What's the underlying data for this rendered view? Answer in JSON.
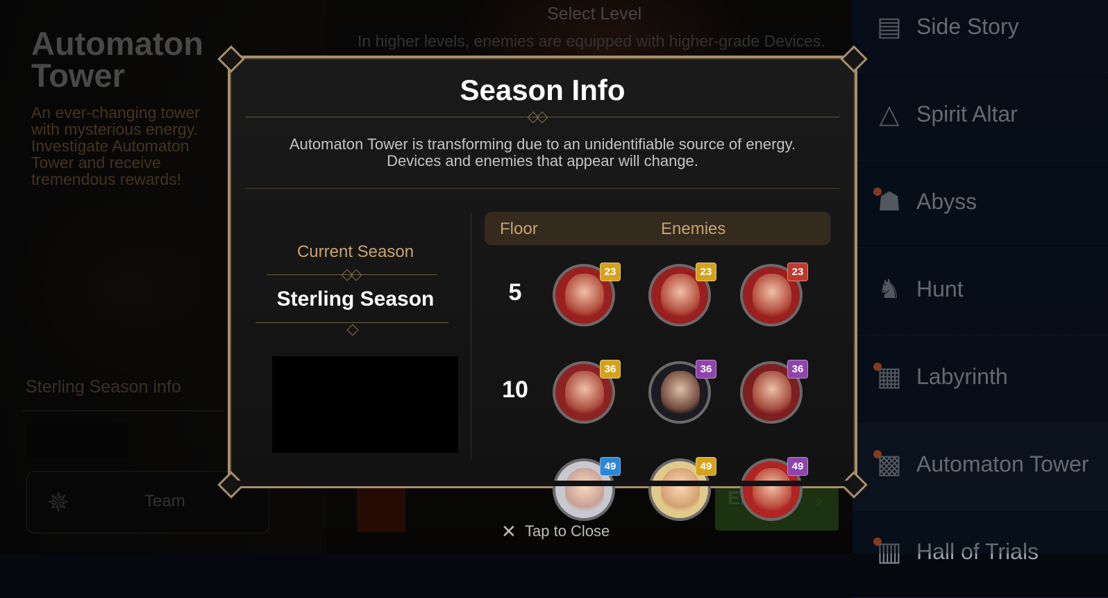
{
  "background": {
    "title": "Automaton Tower",
    "description": "An ever-changing tower with mysterious energy. Investigate Automaton Tower and receive tremendous rewards!",
    "season_info_label": "Sterling Season info",
    "team_label": "Team",
    "select_level": "Select Level",
    "select_level_sub": "In higher levels, enemies are equipped with higher-grade Devices.",
    "enter_label": "Enter",
    "tap_to_close": "Tap to Close"
  },
  "menu": {
    "items": [
      {
        "label": "Side Story",
        "icon": "scroll-icon",
        "dot": false
      },
      {
        "label": "Spirit Altar",
        "icon": "triangle-icon",
        "dot": false
      },
      {
        "label": "Abyss",
        "icon": "monster-icon",
        "dot": true
      },
      {
        "label": "Hunt",
        "icon": "dragon-icon",
        "dot": false
      },
      {
        "label": "Labyrinth",
        "icon": "maze-icon",
        "dot": true
      },
      {
        "label": "Automaton Tower",
        "icon": "tower-icon",
        "dot": true,
        "active": true
      },
      {
        "label": "Hall of Trials",
        "icon": "hall-icon",
        "dot": true
      }
    ]
  },
  "modal": {
    "title": "Season Info",
    "description_line1": "Automaton Tower is transforming due to an unidentifiable source of energy.",
    "description_line2": "Devices and enemies that appear will change.",
    "current_season_label": "Current Season",
    "season_name": "Sterling Season",
    "table_header_floor": "Floor",
    "table_header_enemies": "Enemies",
    "rows": [
      {
        "floor": "5",
        "enemies": [
          {
            "level": "23",
            "badge": "gold"
          },
          {
            "level": "23",
            "badge": "gold"
          },
          {
            "level": "23",
            "badge": "red"
          }
        ]
      },
      {
        "floor": "10",
        "enemies": [
          {
            "level": "36",
            "badge": "gold"
          },
          {
            "level": "36",
            "badge": "purple"
          },
          {
            "level": "36",
            "badge": "purple"
          }
        ]
      },
      {
        "floor": "",
        "enemies": [
          {
            "level": "49",
            "badge": "blue"
          },
          {
            "level": "49",
            "badge": "gold"
          },
          {
            "level": "49",
            "badge": "purple"
          }
        ]
      }
    ]
  },
  "colors": {
    "gold_badge": "#d4a21c",
    "red_badge": "#c0392b",
    "purple_badge": "#8e44ad",
    "blue_badge": "#2d86d6",
    "accent_text": "#c8a371",
    "frame": "#a88f6b"
  }
}
